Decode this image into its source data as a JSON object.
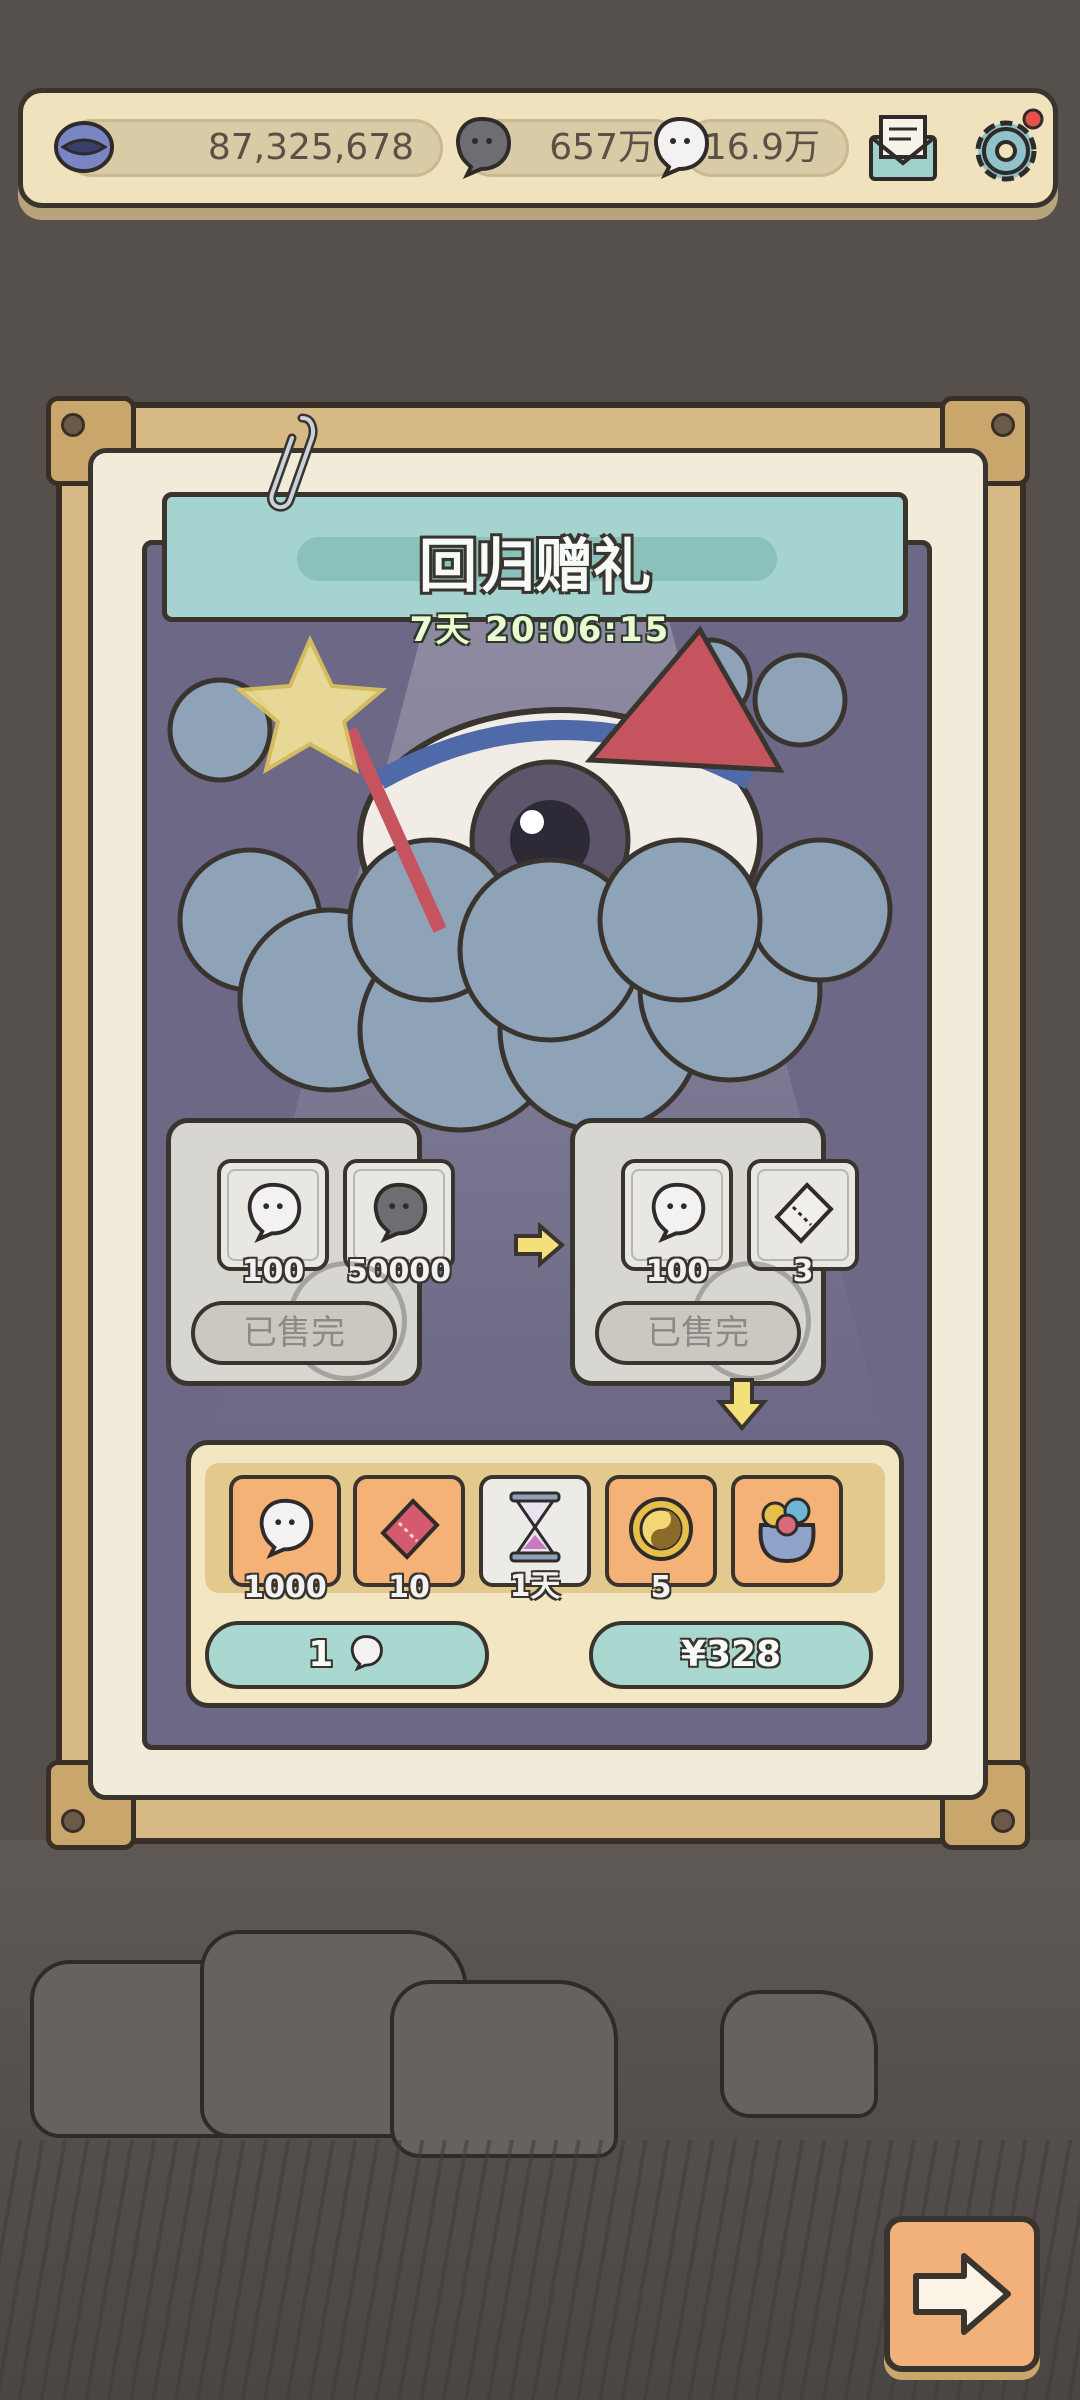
{
  "currencies": {
    "coin_value": "87,325,678",
    "soul_dark_value": "657万",
    "soul_white_value": "16.9万"
  },
  "icons": {
    "coin": "mouth-coin-icon",
    "soul_dark": "dark-soul-icon",
    "soul_white": "white-soul-icon",
    "mail": "mail-icon",
    "settings": "gear-icon",
    "next": "arrow-right-icon"
  },
  "panel": {
    "title": "回归赠礼",
    "timer": "7天 20:06:15"
  },
  "gift_left": {
    "items": [
      {
        "icon": "white-soul-icon",
        "qty": "100"
      },
      {
        "icon": "dark-soul-icon",
        "qty": "50000"
      }
    ],
    "button": "已售完"
  },
  "gift_right": {
    "items": [
      {
        "icon": "white-soul-icon",
        "qty": "100"
      },
      {
        "icon": "ticket-icon",
        "qty": "3"
      }
    ],
    "button": "已售完"
  },
  "gift_bundle": {
    "items": [
      {
        "icon": "white-soul-icon",
        "qty": "1000"
      },
      {
        "icon": "red-ticket-icon",
        "qty": "10"
      },
      {
        "icon": "hourglass-icon",
        "qty": "1天"
      },
      {
        "icon": "yin-yang-coin-icon",
        "qty": "5"
      },
      {
        "icon": "treasure-bag-icon",
        "qty": ""
      }
    ],
    "price_soul": "1",
    "price_cny": "¥328"
  },
  "colors": {
    "accent_teal": "#a5d3cf",
    "frame": "#d6b985",
    "orange_slot": "#f4b277"
  }
}
